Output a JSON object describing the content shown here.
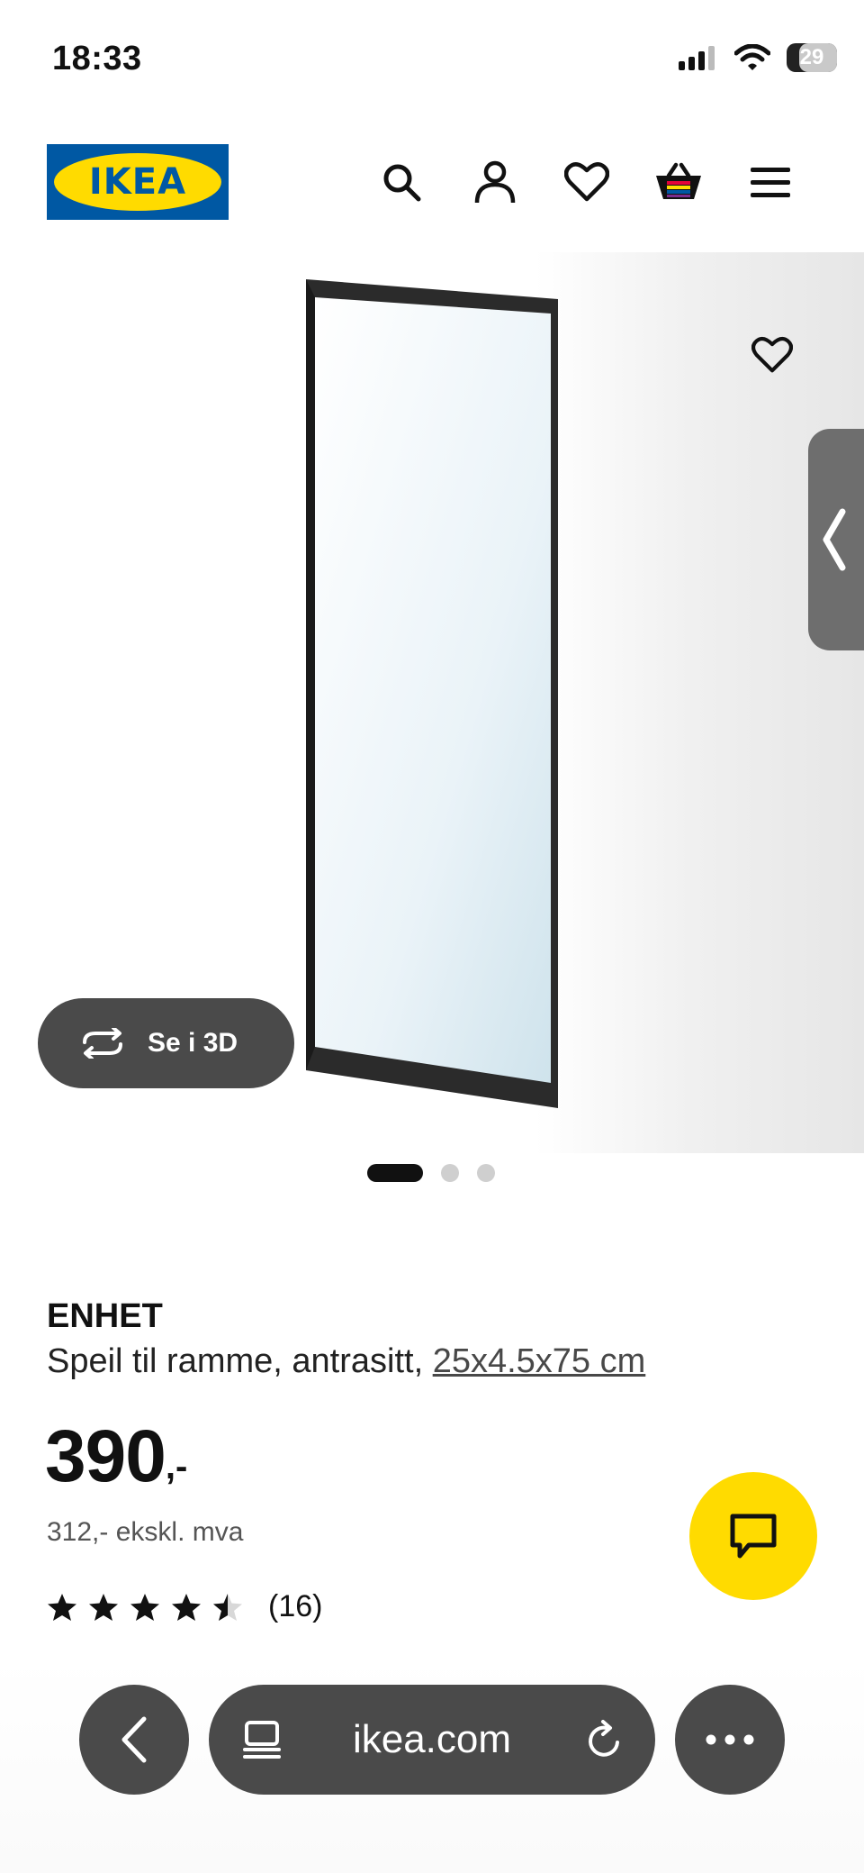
{
  "status_bar": {
    "time": "18:33",
    "battery": "29"
  },
  "header": {
    "logo_text": "IKEA",
    "icons": [
      "search-icon",
      "account-icon",
      "favorites-icon",
      "basket-icon",
      "menu-icon"
    ]
  },
  "gallery": {
    "see_3d_label": "Se i 3D",
    "slide_count": 3,
    "active_slide": 1
  },
  "product": {
    "name": "ENHET",
    "description": "Speil til ramme, antrasitt, ",
    "size": "25x4.5x75 cm",
    "price_main": "390",
    "price_suffix": ",-",
    "price_ex_vat": "312,- ekskl. mva",
    "rating_value": 4.5,
    "rating_max": 5,
    "review_count": "(16)"
  },
  "browser": {
    "url": "ikea.com"
  },
  "colors": {
    "ikea_blue": "#0058a3",
    "ikea_yellow": "#ffdb00",
    "dark_button": "#4a4a4a"
  }
}
